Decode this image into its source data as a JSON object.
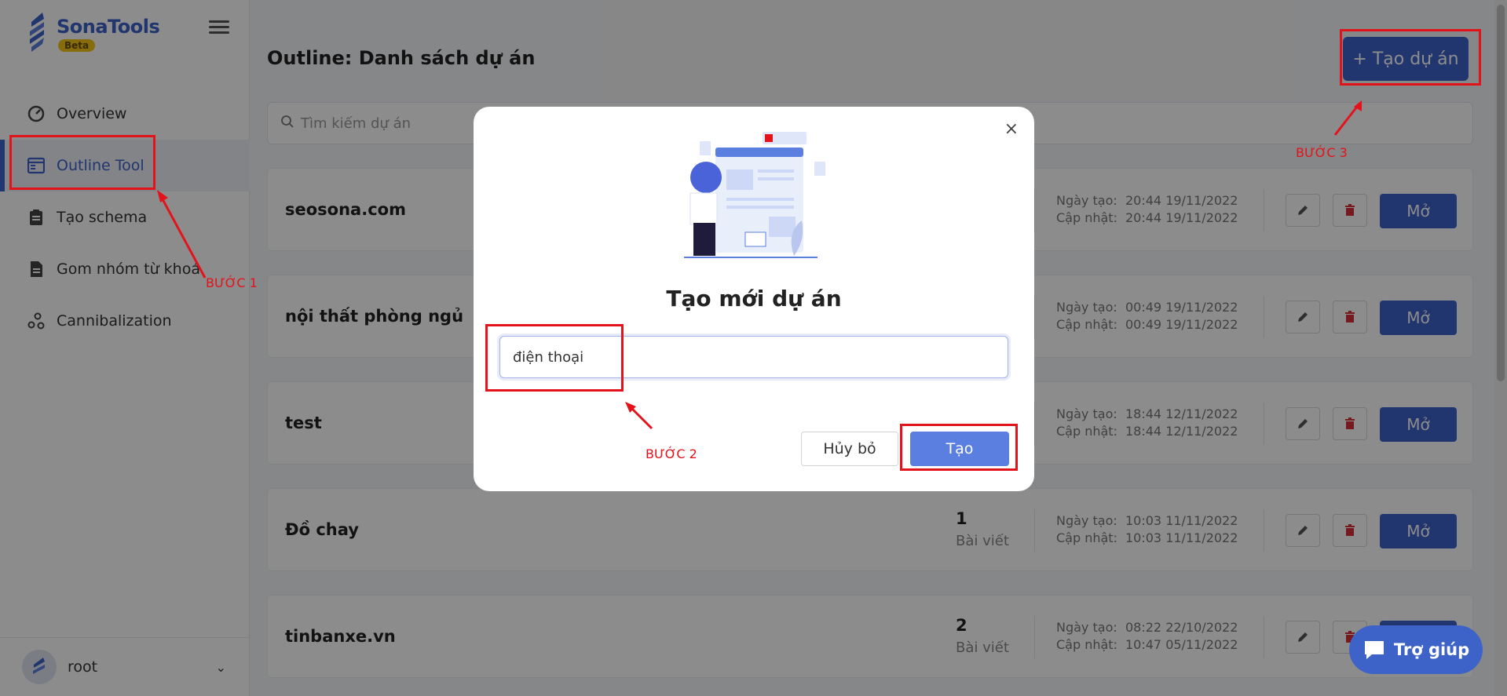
{
  "brand": {
    "name": "SonaTools",
    "badge": "Beta",
    "accent": "#3d63c9"
  },
  "sidebar": {
    "items": [
      {
        "label": "Overview",
        "icon": "speedometer-icon",
        "active": false
      },
      {
        "label": "Outline Tool",
        "icon": "window-icon",
        "active": true
      },
      {
        "label": "Tạo schema",
        "icon": "clipboard-icon",
        "active": false
      },
      {
        "label": "Gom nhóm từ khoá",
        "icon": "document-icon",
        "active": false
      },
      {
        "label": "Cannibalization",
        "icon": "nodes-icon",
        "active": false
      }
    ],
    "user": {
      "name": "root"
    }
  },
  "main": {
    "title": "Outline: Danh sách dự án",
    "create_button": "+ Tạo dự án",
    "search_placeholder": "Tìm kiếm dự án",
    "projects": [
      {
        "name": "seosona.com",
        "count": "",
        "count_label": "",
        "created_label": "Ngày tạo:",
        "created": "20:44 19/11/2022",
        "updated_label": "Cập nhật:",
        "updated": "20:44 19/11/2022",
        "open_label": "Mở"
      },
      {
        "name": "nội thất phòng ngủ",
        "count": "",
        "count_label": "",
        "created_label": "Ngày tạo:",
        "created": "00:49 19/11/2022",
        "updated_label": "Cập nhật:",
        "updated": "00:49 19/11/2022",
        "open_label": "Mở"
      },
      {
        "name": "test",
        "count": "",
        "count_label": "",
        "created_label": "Ngày tạo:",
        "created": "18:44 12/11/2022",
        "updated_label": "Cập nhật:",
        "updated": "18:44 12/11/2022",
        "open_label": "Mở"
      },
      {
        "name": "Đồ chay",
        "count": "1",
        "count_label": "Bài viết",
        "created_label": "Ngày tạo:",
        "created": "10:03 11/11/2022",
        "updated_label": "Cập nhật:",
        "updated": "10:03 11/11/2022",
        "open_label": "Mở"
      },
      {
        "name": "tinbanxe.vn",
        "count": "2",
        "count_label": "Bài viết",
        "created_label": "Ngày tạo:",
        "created": "08:22 22/10/2022",
        "updated_label": "Cập nhật:",
        "updated": "10:47 05/11/2022",
        "open_label": "Mở"
      }
    ]
  },
  "modal": {
    "title": "Tạo mới dự án",
    "input_value": "điện thoại",
    "cancel_label": "Hủy bỏ",
    "submit_label": "Tạo",
    "close_symbol": "×"
  },
  "help": {
    "label": "Trợ giúp"
  },
  "annotations": {
    "step1": "BƯỚC 1",
    "step2": "BƯỚC 2",
    "step3": "BƯỚC 3",
    "color": "#e3131b"
  }
}
